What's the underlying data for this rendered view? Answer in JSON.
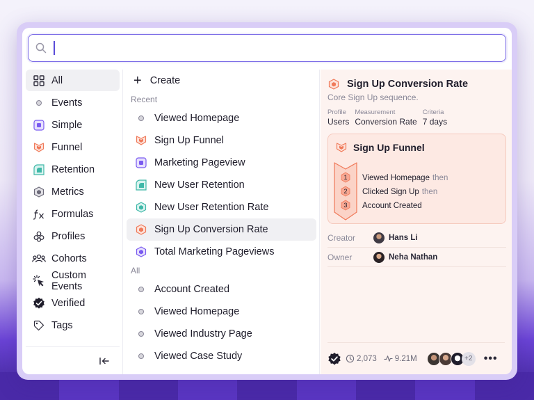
{
  "search": {
    "placeholder": "",
    "value": ""
  },
  "sidebar": {
    "items": [
      {
        "label": "All",
        "icon": "grid-icon",
        "active": true
      },
      {
        "label": "Events",
        "icon": "event-dot-icon"
      },
      {
        "label": "Simple",
        "icon": "simple-report-icon"
      },
      {
        "label": "Funnel",
        "icon": "funnel-icon"
      },
      {
        "label": "Retention",
        "icon": "retention-icon"
      },
      {
        "label": "Metrics",
        "icon": "metrics-icon"
      },
      {
        "label": "Formulas",
        "icon": "formula-fx-icon"
      },
      {
        "label": "Profiles",
        "icon": "profiles-icon"
      },
      {
        "label": "Cohorts",
        "icon": "cohorts-icon"
      },
      {
        "label": "Custom Events",
        "icon": "custom-events-icon"
      },
      {
        "label": "Verified",
        "icon": "verified-badge-icon"
      },
      {
        "label": "Tags",
        "icon": "tag-icon"
      }
    ],
    "collapse_icon": "collapse-left-icon"
  },
  "list": {
    "create_label": "Create",
    "recent_label": "Recent",
    "recent": [
      {
        "label": "Viewed Homepage",
        "icon": "event-dot-icon"
      },
      {
        "label": "Sign Up Funnel",
        "icon": "funnel-icon"
      },
      {
        "label": "Marketing Pageview",
        "icon": "simple-report-icon"
      },
      {
        "label": "New User Retention",
        "icon": "retention-icon"
      },
      {
        "label": "New User Retention Rate",
        "icon": "retention-metric-icon"
      },
      {
        "label": "Sign Up Conversion Rate",
        "icon": "funnel-metric-icon",
        "active": true
      },
      {
        "label": "Total Marketing Pageviews",
        "icon": "simple-metric-icon"
      }
    ],
    "all_label": "All",
    "all": [
      {
        "label": "Account Created",
        "icon": "event-dot-icon"
      },
      {
        "label": "Viewed Homepage",
        "icon": "event-dot-icon"
      },
      {
        "label": "Viewed Industry Page",
        "icon": "event-dot-icon"
      },
      {
        "label": "Viewed Case Study",
        "icon": "event-dot-icon"
      }
    ]
  },
  "detail": {
    "title": "Sign Up Conversion Rate",
    "description": "Core Sign Up sequence.",
    "meta": [
      {
        "key": "Profile",
        "value": "Users"
      },
      {
        "key": "Measurement",
        "value": "Conversion Rate"
      },
      {
        "key": "Criteria",
        "value": "7 days"
      }
    ],
    "funnel": {
      "title": "Sign Up Funnel",
      "steps": [
        {
          "num": "1",
          "label": "Viewed Homepage",
          "suffix": "then"
        },
        {
          "num": "2",
          "label": "Clicked Sign Up",
          "suffix": "then"
        },
        {
          "num": "3",
          "label": "Account Created",
          "suffix": ""
        }
      ]
    },
    "creator_label": "Creator",
    "creator": "Hans Li",
    "owner_label": "Owner",
    "owner": "Neha Nathan",
    "footer": {
      "views": "2,073",
      "events": "9.21M",
      "more_count": "+2"
    }
  },
  "colors": {
    "accent": "#7b6be6",
    "funnel": "#f07a5a",
    "retention": "#3fb8a8",
    "simple": "#7a5af0",
    "detail_bg": "#fdf3f0"
  }
}
